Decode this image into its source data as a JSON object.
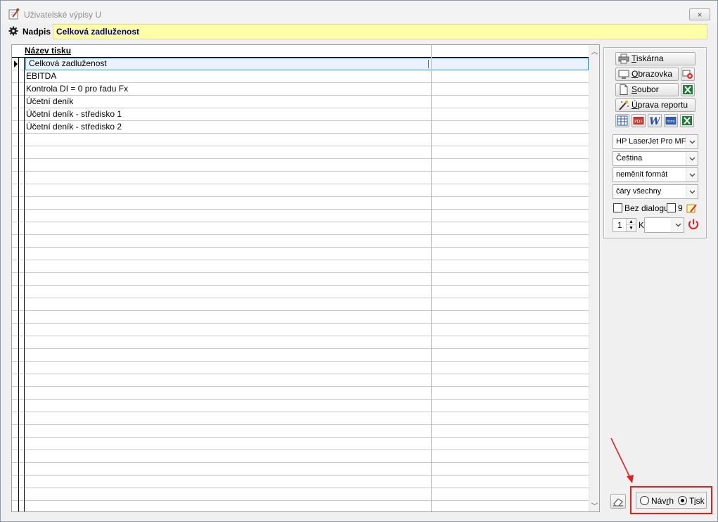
{
  "window": {
    "title": "Uživatelské výpisy U",
    "close_icon": "×"
  },
  "caption": {
    "label": "Nadpis",
    "value": "Celková zadluženost"
  },
  "grid": {
    "column_header": "Název tisku",
    "rows": [
      "Celková zadluženost",
      "EBITDA",
      "Kontrola DI = 0 pro řadu Fx",
      "Účetní deník",
      "Účetní deník - středisko 1",
      "Účetní deník - středisko 2"
    ],
    "selected_index": 0
  },
  "panel": {
    "printer_button": {
      "underline": "T",
      "rest": "iskárna"
    },
    "screen_button": {
      "underline": "O",
      "rest": "brazovka"
    },
    "file_button": {
      "underline": "S",
      "rest": "oubor"
    },
    "edit_report_button": {
      "underline": "Ú",
      "rest": "prava reportu"
    },
    "format_icons": [
      "table-icon",
      "pdf-icon",
      "word-icon",
      "html-icon",
      "excel-icon"
    ],
    "printer_select": "HP LaserJet Pro MFP",
    "language_select": "Čeština",
    "format_select": "neměnit formát",
    "lines_select": "čáry všechny",
    "no_dialog_label": "Bez dialogu",
    "nine_label": "9",
    "copies_value": "1",
    "copies_suffix": "K"
  },
  "mode": {
    "draft_label": "Návrh",
    "draft_underline": "r",
    "print_label": "Tisk",
    "print_underline": "i",
    "selected": "print"
  },
  "colors": {
    "caption_bg": "#ffffa8",
    "caption_text": "#00007a",
    "highlight": "#e02020",
    "selection_border": "#3c8bd0"
  }
}
